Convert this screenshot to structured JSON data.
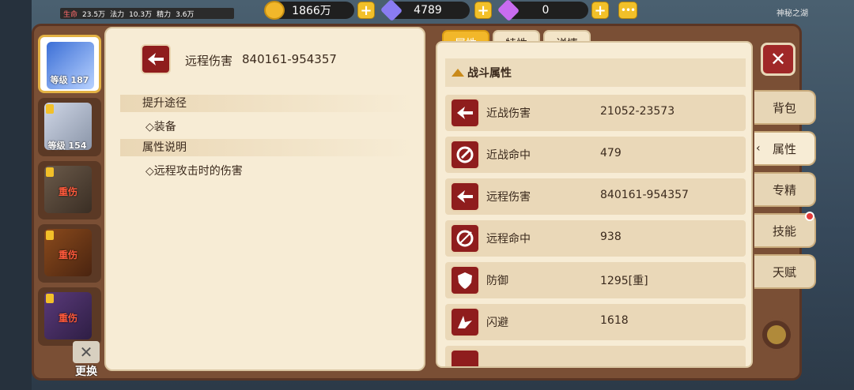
{
  "topbar": {
    "mini_stats": {
      "hp_label": "生命",
      "hp_val": "23.5万",
      "mp_label": "法力",
      "mp_val": "10.3万",
      "extra_label": "精力",
      "extra_val": "3.6万"
    },
    "gold": "1866万",
    "diamond": "4789",
    "gem": "0",
    "location": "神秘之湖"
  },
  "heroes": [
    {
      "level": "等级 187",
      "status": "",
      "selected": true
    },
    {
      "level": "等级 154",
      "status": "",
      "selected": false
    },
    {
      "level": "",
      "status": "重伤",
      "selected": false
    },
    {
      "level": "",
      "status": "重伤",
      "selected": false
    },
    {
      "level": "",
      "status": "重伤",
      "selected": false
    }
  ],
  "swap_label": "更换",
  "detail": {
    "title": "远程伤害",
    "value": "840161-954357",
    "section1": "提升途径",
    "item1": "◇装备",
    "section2": "属性说明",
    "item2": "◇远程攻击时的伤害"
  },
  "tabs": [
    {
      "label": "属性",
      "active": true
    },
    {
      "label": "特性",
      "active": false
    },
    {
      "label": "详情",
      "active": false
    }
  ],
  "group_title": "战斗属性",
  "attributes": [
    {
      "name": "近战伤害",
      "value": "21052-23573",
      "icon": "melee-damage-icon"
    },
    {
      "name": "近战命中",
      "value": "479",
      "icon": "melee-hit-icon"
    },
    {
      "name": "远程伤害",
      "value": "840161-954357",
      "icon": "ranged-damage-icon"
    },
    {
      "name": "远程命中",
      "value": "938",
      "icon": "ranged-hit-icon"
    },
    {
      "name": "防御",
      "value": "1295[重]",
      "icon": "defense-icon"
    },
    {
      "name": "闪避",
      "value": "1618",
      "icon": "dodge-icon"
    }
  ],
  "side_nav": [
    "背包",
    "属性",
    "专精",
    "技能",
    "天赋"
  ],
  "colors": {
    "frame": "#7a4f35",
    "paper": "#f7ecd5",
    "accent": "#f2b72a",
    "icon_red": "#8f1d1d"
  }
}
